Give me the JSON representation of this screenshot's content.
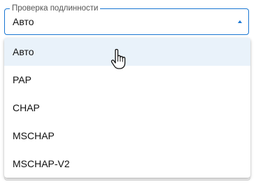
{
  "field": {
    "label": "Проверка подлинности",
    "selected": "Авто",
    "accent_color": "#1976d2"
  },
  "dropdown": {
    "options": [
      {
        "label": "Авто",
        "hovered": true
      },
      {
        "label": "PAP",
        "hovered": false
      },
      {
        "label": "CHAP",
        "hovered": false
      },
      {
        "label": "MSCHAP",
        "hovered": false
      },
      {
        "label": "MSCHAP-V2",
        "hovered": false
      }
    ],
    "hover_color": "#e9f2fa"
  },
  "cursor": {
    "icon": "hand-pointer-icon"
  }
}
